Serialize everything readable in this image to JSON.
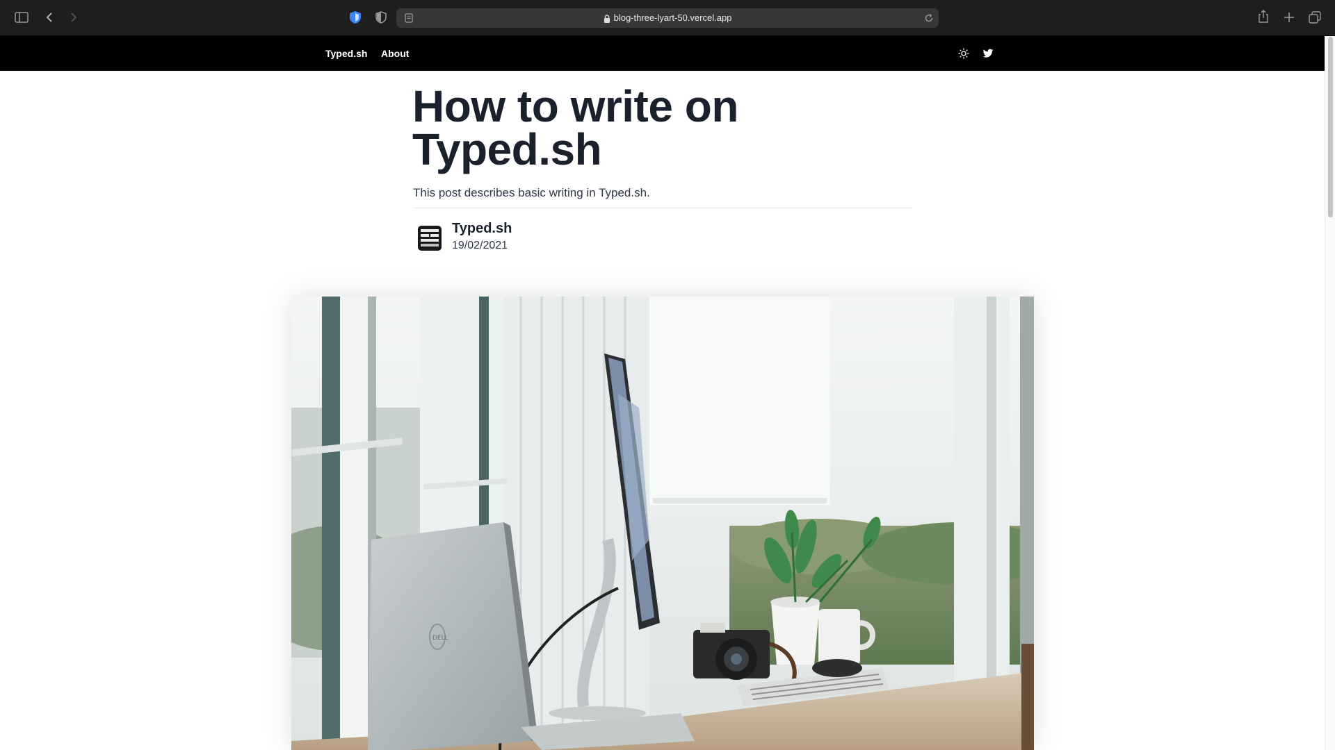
{
  "browser": {
    "url": "blog-three-lyart-50.vercel.app",
    "icons": [
      "sidebar-icon",
      "back-icon",
      "forward-icon",
      "bitwarden-shield-icon",
      "privacy-shield-icon",
      "reader-icon",
      "lock-icon",
      "reload-icon",
      "share-icon",
      "new-tab-icon",
      "tab-overview-icon"
    ]
  },
  "nav": {
    "brand": "Typed.sh",
    "about": "About",
    "icons": [
      "theme-toggle-icon",
      "twitter-icon"
    ]
  },
  "post": {
    "title": "How to write on Typed.sh",
    "description": "This post describes basic writing in Typed.sh.",
    "author": "Typed.sh",
    "date": "19/02/2021",
    "logo": "DELL"
  },
  "colors": {
    "nav_bg": "#000000",
    "title": "#1a202c",
    "text": "#2d3748",
    "accent_shield": "#3b82f6"
  }
}
